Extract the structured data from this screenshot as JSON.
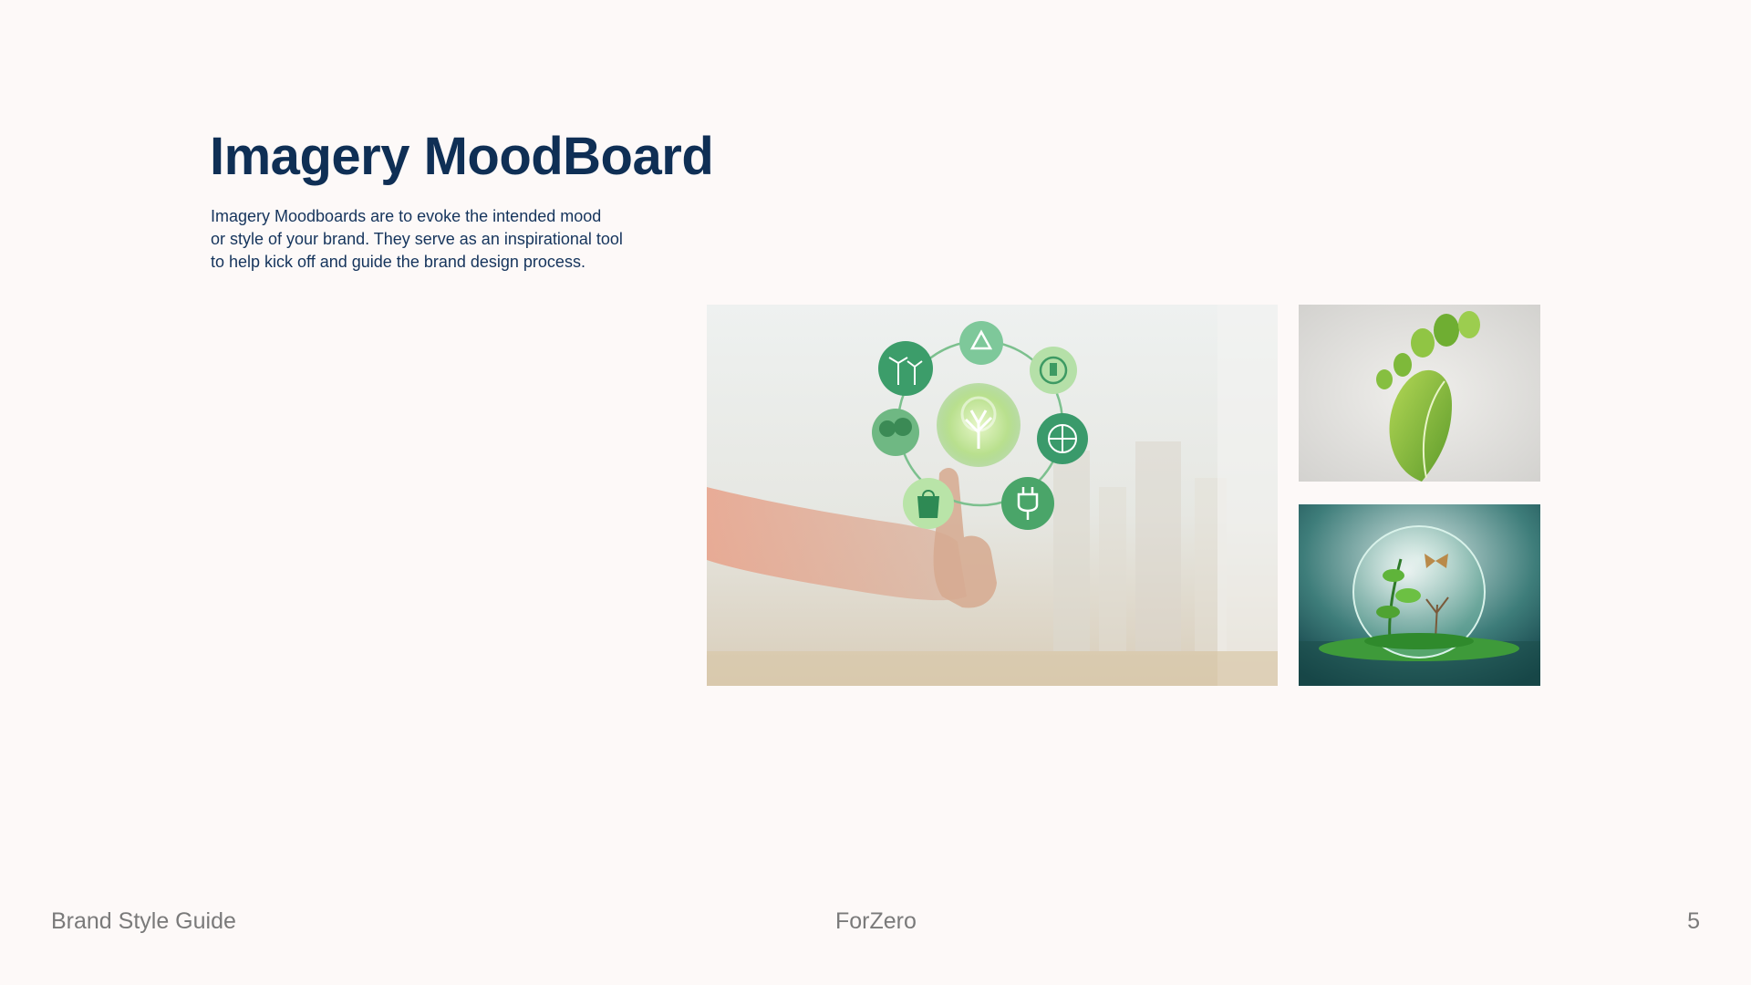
{
  "page": {
    "title": "Imagery MoodBoard",
    "description_lines": [
      "Imagery Moodboards are to evoke the intended mood",
      "or style of your brand. They serve as an inspirational tool",
      "to help kick off and guide the brand design process."
    ]
  },
  "footer": {
    "left": "Brand Style Guide",
    "center": "ForZero",
    "right": "5"
  },
  "colors": {
    "background": "#fdf9f8",
    "title": "#0f2f55",
    "footer_text": "#7a7a7a",
    "accent_green": "#3fa66a"
  },
  "images": [
    {
      "subject": "hand touching sustainability icon circle",
      "icons": [
        "wind-turbine-icon",
        "recycle-icon",
        "battery-cycle-icon",
        "trees-icon",
        "tree-center-icon",
        "globe-icon",
        "recycle-bag-icon",
        "plug-icon"
      ]
    },
    {
      "subject": "leaves arranged as footprint"
    },
    {
      "subject": "glass sphere with plants and butterfly"
    }
  ]
}
